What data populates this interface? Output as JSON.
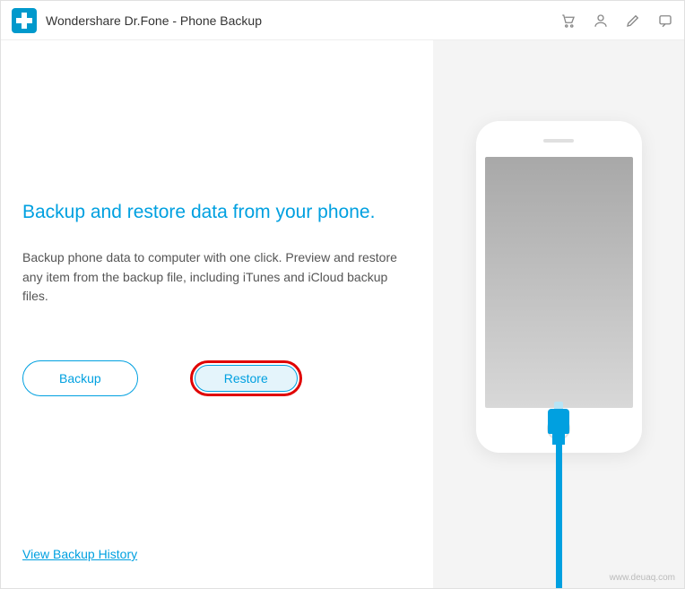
{
  "titlebar": {
    "app_title": "Wondershare Dr.Fone - Phone Backup",
    "icons": {
      "cart": "cart-icon",
      "account": "account-icon",
      "edit": "edit-icon",
      "feedback": "feedback-icon"
    }
  },
  "main": {
    "heading": "Backup and restore data from your phone.",
    "description": "Backup phone data to computer with one click. Preview and restore any item from the backup file, including iTunes and iCloud backup files.",
    "backup_button": "Backup",
    "restore_button": "Restore",
    "history_link": "View Backup History"
  },
  "watermark": "www.deuaq.com",
  "colors": {
    "accent": "#00a0e0",
    "highlight_ring": "#e00000"
  }
}
